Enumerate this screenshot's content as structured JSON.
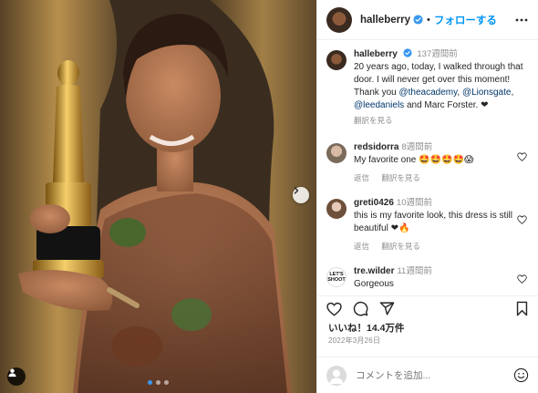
{
  "post": {
    "username": "halleberry",
    "follow_label": "フォローする",
    "separator": "•"
  },
  "caption": {
    "username": "halleberry",
    "time": "137週間前",
    "text_1": "20 years ago, today, I walked through that door. I will never get over this moment! Thank you ",
    "mention_1": "@theacademy",
    "text_2": ", ",
    "mention_2": "@Lionsgate",
    "text_3": ", ",
    "mention_3": "@leedaniels",
    "text_4": " and Marc Forster. ❤",
    "translate": "翻訳を見る"
  },
  "comments": [
    {
      "username": "redsidorra",
      "time": "8週間前",
      "text": "My favorite one 🤩🤩🤩🤩😱",
      "reply": "返信",
      "translate": "翻訳を見る"
    },
    {
      "username": "greti0426",
      "time": "10週間前",
      "text": "this is my favorite look, this dress is still beautiful ❤🔥",
      "reply": "返信",
      "translate": "翻訳を見る"
    },
    {
      "username": "tre.wilder",
      "time": "11週間前",
      "text": "Gorgeous",
      "avatar_text": "LET'S SHOOT"
    }
  ],
  "likes_label": "いいね！14.4万件",
  "date_label": "2022年3月26日",
  "add_comment": {
    "placeholder": "コメントを追加..."
  },
  "carousel": {
    "count": 3,
    "active": 1
  },
  "colors": {
    "accent": "#0095f6",
    "text": "#262626",
    "muted": "#8e8e8e",
    "link": "#00376b",
    "heart_red": "#ed4956"
  },
  "icons": [
    "verified-badge-icon",
    "more-options-icon",
    "heart-icon",
    "comment-icon",
    "share-icon",
    "save-icon",
    "emoji-icon",
    "next-arrow-icon",
    "tag-user-icon"
  ]
}
